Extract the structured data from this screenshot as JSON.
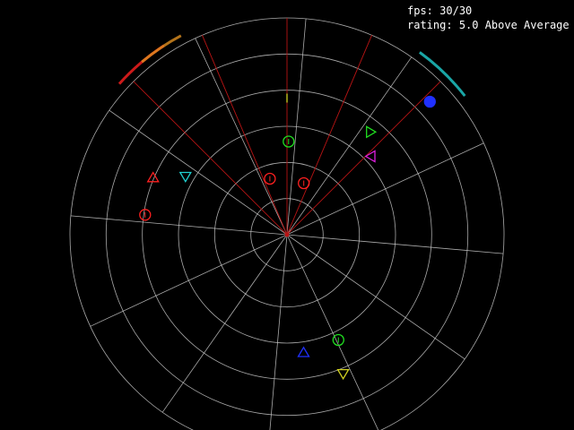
{
  "hud": {
    "fps_label": "fps:",
    "fps_value": "30/30",
    "rating_label": "rating:",
    "rating_value": "5.0 Above Average"
  },
  "colors": {
    "background": "#000000",
    "grid": "#c8c8c8",
    "scan_lines": "#b81414",
    "red": "#ff2020",
    "green": "#20e020",
    "blue": "#2030ff",
    "cyan": "#20d0d0",
    "magenta": "#e020e0",
    "yellow": "#d0d020",
    "orange": "#e09020"
  },
  "radar": {
    "rings": 6,
    "spokes": 12,
    "scan_line_bearings_deg": [
      -45,
      -23,
      0,
      23,
      45
    ]
  },
  "contacts": [
    {
      "name": "contact-red-circle-left",
      "shape": "circle",
      "color": "red",
      "filled": false,
      "bearing_deg": -82,
      "range": 0.66
    },
    {
      "name": "contact-red-triangle-up",
      "shape": "triangle-up",
      "color": "red",
      "filled": false,
      "bearing_deg": -67,
      "range": 0.67
    },
    {
      "name": "contact-cyan-triangle-down",
      "shape": "triangle-down",
      "color": "cyan",
      "filled": false,
      "bearing_deg": -60,
      "range": 0.54
    },
    {
      "name": "contact-red-circle-center-left",
      "shape": "circle",
      "color": "red",
      "filled": false,
      "bearing_deg": -17,
      "range": 0.27
    },
    {
      "name": "contact-red-circle-center-right",
      "shape": "circle",
      "color": "red",
      "filled": false,
      "bearing_deg": 18,
      "range": 0.25
    },
    {
      "name": "contact-green-circle-top",
      "shape": "circle",
      "color": "green",
      "filled": false,
      "bearing_deg": 1,
      "range": 0.43
    },
    {
      "name": "contact-yellow-tick-top",
      "shape": "tick",
      "color": "yellow",
      "filled": false,
      "bearing_deg": 0,
      "range": 0.63
    },
    {
      "name": "contact-green-triangle-right",
      "shape": "triangle-right",
      "color": "green",
      "filled": false,
      "bearing_deg": 39,
      "range": 0.61
    },
    {
      "name": "contact-magenta-triangle-left",
      "shape": "triangle-left",
      "color": "magenta",
      "filled": false,
      "bearing_deg": 47,
      "range": 0.53
    },
    {
      "name": "contact-blue-circle-filled",
      "shape": "circle",
      "color": "blue",
      "filled": true,
      "bearing_deg": 47,
      "range": 0.9
    },
    {
      "name": "contact-green-circle-bottom",
      "shape": "circle",
      "color": "green",
      "filled": false,
      "bearing_deg": 154,
      "range": 0.54
    },
    {
      "name": "contact-blue-triangle-up-bottom",
      "shape": "triangle-up",
      "color": "blue",
      "filled": false,
      "bearing_deg": 172,
      "range": 0.55
    },
    {
      "name": "contact-yellow-triangle-down-bottom",
      "shape": "triangle-down",
      "color": "yellow",
      "filled": false,
      "bearing_deg": 158,
      "range": 0.69
    }
  ],
  "edge_arcs": [
    {
      "name": "edge-arc-red",
      "color": "red",
      "from_deg": -48,
      "to_deg": -33
    },
    {
      "name": "edge-arc-orange",
      "color": "orange",
      "from_deg": -40,
      "to_deg": -28
    },
    {
      "name": "edge-arc-cyan",
      "color": "cyan",
      "from_deg": 36,
      "to_deg": 52
    }
  ]
}
